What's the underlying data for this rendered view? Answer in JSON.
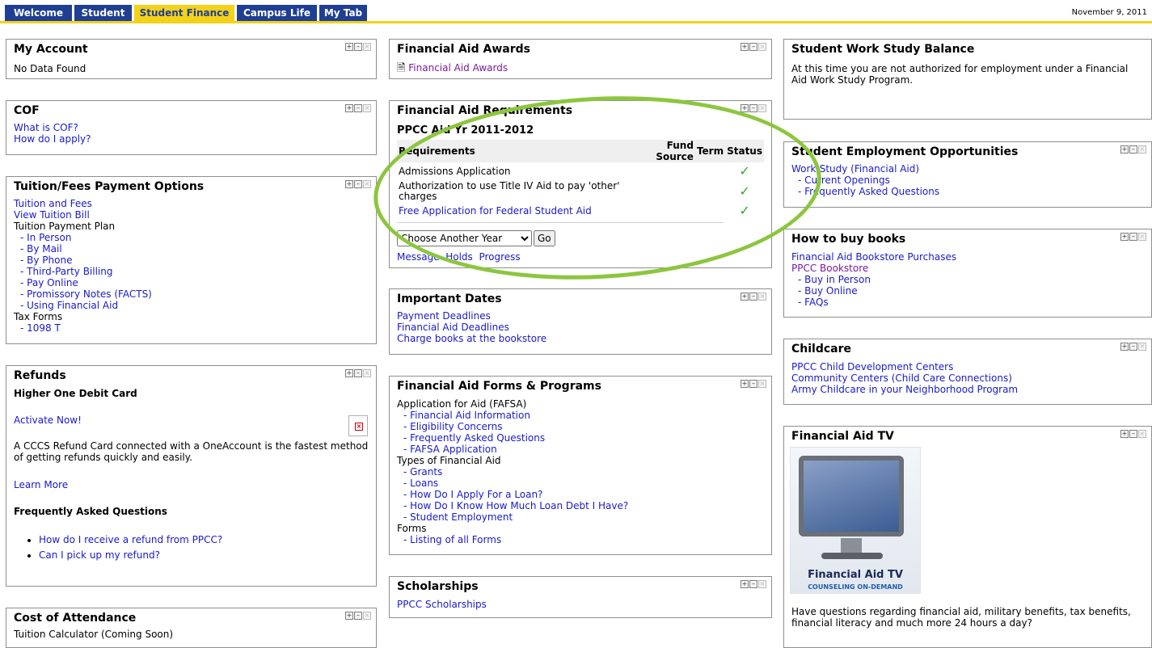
{
  "nav": {
    "tabs": [
      "Welcome",
      "Student",
      "Student Finance",
      "Campus Life",
      "My Tab"
    ],
    "active_tab": "Student Finance",
    "date": "November 9, 2011"
  },
  "portlet_controls": {
    "expand": "+",
    "minimize": "–",
    "close": "×"
  },
  "my_account": {
    "title": "My Account",
    "body": "No Data Found"
  },
  "cof": {
    "title": "COF",
    "links": [
      "What is COF?",
      "How do I apply?"
    ]
  },
  "tuition": {
    "title": "Tuition/Fees Payment Options",
    "links_top": [
      "Tuition and Fees",
      "View Tuition Bill"
    ],
    "plan_label": "Tuition Payment Plan",
    "plan_items": [
      "- In Person",
      "- By Mail",
      "- By Phone",
      "- Third-Party Billing",
      "- Pay Online",
      "- Promissory Notes (FACTS)",
      "- Using Financial Aid"
    ],
    "tax_label": "Tax Forms",
    "tax_items": [
      "- 1098 T"
    ]
  },
  "refunds": {
    "title": "Refunds",
    "subtitle": "Higher One Debit Card",
    "activate": "Activate Now!",
    "description": "A CCCS Refund Card connected with a OneAccount is the fastest method of getting refunds quickly and easily.",
    "learn_more": "Learn More",
    "faq_heading": "Frequently Asked Questions",
    "faq_items": [
      "How do I receive a refund from PPCC?",
      "Can I pick up my refund?"
    ]
  },
  "cost": {
    "title": "Cost of Attendance",
    "body": "Tuition Calculator (Coming Soon)"
  },
  "fa_awards": {
    "title": "Financial Aid Awards",
    "link": "Financial Aid Awards"
  },
  "fa_requirements": {
    "title": "Financial Aid Requirements",
    "aid_year": "PPCC Aid Yr 2011-2012",
    "columns": [
      "Requirements",
      "Fund Source",
      "Term",
      "Status"
    ],
    "rows": [
      {
        "requirement": "Admissions Application",
        "status": "✓"
      },
      {
        "requirement": "Authorization to use Title IV Aid to pay 'other' charges",
        "status": "✓"
      },
      {
        "requirement": "Free Application for Federal Student Aid",
        "status": "✓"
      }
    ],
    "select_value": "Choose Another Year",
    "go_label": "Go",
    "links": [
      "Message",
      "Holds",
      "Progress"
    ]
  },
  "important_dates": {
    "title": "Important Dates",
    "links": [
      "Payment Deadlines",
      "Financial Aid Deadlines",
      "Charge books at the bookstore"
    ]
  },
  "fa_forms": {
    "title": "Financial Aid Forms & Programs",
    "app_label": "Application for Aid (FAFSA)",
    "app_items": [
      "- Financial Aid Information",
      "- Eligibility Concerns",
      "- Frequently Asked Questions",
      "- FAFSA Application"
    ],
    "types_label": "Types of Financial Aid",
    "types_items": [
      "- Grants",
      "- Loans",
      "- How Do I Apply For a Loan?",
      "- How Do I Know How Much Loan Debt I Have?",
      "- Student Employment"
    ],
    "forms_label": "Forms",
    "forms_items": [
      "- Listing of all Forms"
    ]
  },
  "scholarships": {
    "title": "Scholarships",
    "link": "PPCC Scholarships"
  },
  "work_study": {
    "title": "Student Work Study Balance",
    "body": "At this time you are not authorized for employment under a Financial Aid Work Study Program."
  },
  "employment": {
    "title": "Student Employment Opportunities",
    "link": "Work-Study (Financial Aid)",
    "items": [
      "- Current Openings",
      "- Frequently Asked Questions"
    ]
  },
  "books": {
    "title": "How to buy books",
    "link1": "Financial Aid Bookstore Purchases",
    "link2": "PPCC Bookstore",
    "items": [
      "- Buy in Person",
      "- Buy Online",
      "- FAQs"
    ]
  },
  "childcare": {
    "title": "Childcare",
    "links": [
      "PPCC Child Development Centers",
      "Community Centers (Child Care Connections)",
      "Army Childcare in your Neighborhood Program"
    ]
  },
  "fa_tv": {
    "title": "Financial Aid TV",
    "image_title": "Financial Aid TV",
    "image_subtitle": "COUNSELING ON-DEMAND",
    "body": "Have questions regarding financial aid, military benefits, tax benefits, financial literacy and much more 24 hours a day?"
  }
}
